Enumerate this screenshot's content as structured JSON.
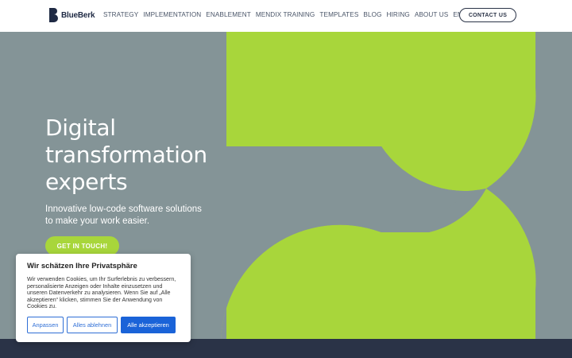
{
  "header": {
    "brand": "BlueBerk",
    "nav": [
      "STRATEGY",
      "IMPLEMENTATION",
      "ENABLEMENT",
      "MENDIX TRAINING",
      "TEMPLATES",
      "BLOG",
      "HIRING",
      "ABOUT US"
    ],
    "language": "EN",
    "contact_label": "CONTACT US"
  },
  "hero": {
    "title_lines": [
      "Digital",
      "transformation",
      "experts"
    ],
    "subtitle_lines": [
      "Innovative low-code software solutions",
      "to make your work easier."
    ],
    "cta_label": "GET IN TOUCH!"
  },
  "cookie": {
    "title": "Wir schätzen Ihre Privatsphäre",
    "text": "Wir verwenden Cookies, um Ihr Surferlebnis zu verbessern, personalisierte Anzeigen oder Inhalte einzusetzen und unseren Datenverkehr zu analysieren. Wenn Sie auf „Alle akzeptieren“ klicken, stimmen Sie der Anwendung von Cookies zu.",
    "customize": "Anpassen",
    "reject": "Alles ablehnen",
    "accept": "Alle akzeptieren"
  },
  "colors": {
    "hero_bg": "#849497",
    "accent_green": "#a8d63b",
    "navy": "#2a3347",
    "cookie_button_blue": "#1a63d8"
  },
  "icons": {
    "logo": "blueberk-logo-icon",
    "language_dropdown": "chevron-down-icon"
  }
}
